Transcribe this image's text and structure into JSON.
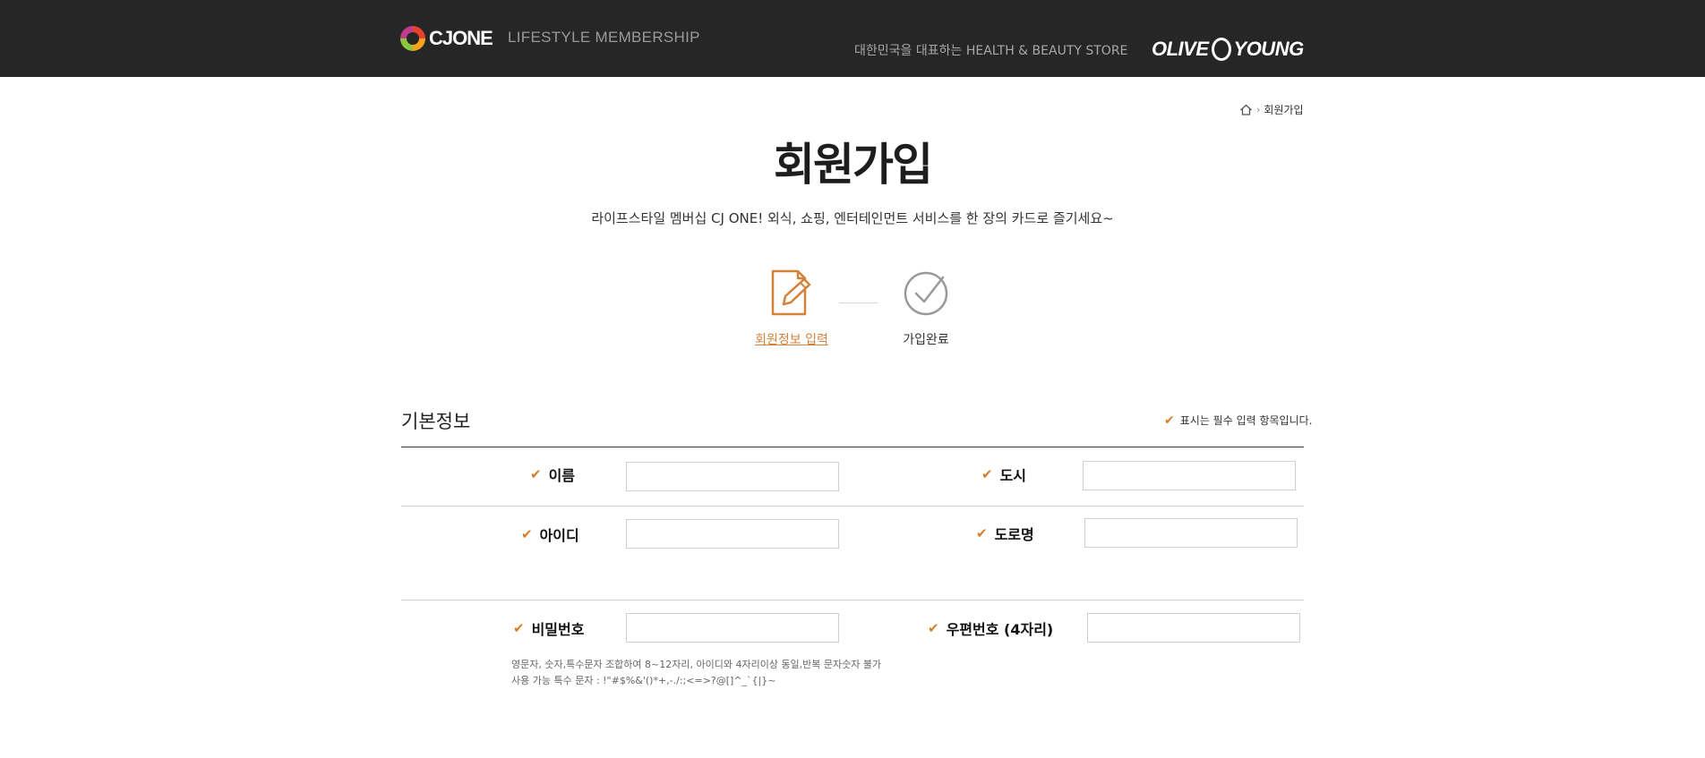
{
  "header": {
    "logo_text": "CJONE",
    "tagline": "LIFESTYLE MEMBERSHIP",
    "store_line": "대한민국을 대표하는 HEALTH & BEAUTY STORE",
    "oy_left": "OLIVE",
    "oy_right": "YOUNG"
  },
  "breadcrumb": {
    "current": "회원가입"
  },
  "page": {
    "title": "회원가입",
    "subtitle": "라이프스타일 멤버십 CJ ONE! 외식, 쇼핑, 엔터테인먼트 서비스를 한 장의 카드로 즐기세요~"
  },
  "steps": [
    {
      "label": "회원정보 입력"
    },
    {
      "label": "가입완료"
    }
  ],
  "section": {
    "title": "기본정보",
    "required_note": "표시는 필수 입력 항목입니다."
  },
  "fields": {
    "name": {
      "label": "이름",
      "value": ""
    },
    "city": {
      "label": "도시",
      "value": ""
    },
    "id": {
      "label": "아이디",
      "value": ""
    },
    "road": {
      "label": "도로명",
      "value": ""
    },
    "password": {
      "label": "비밀번호",
      "value": ""
    },
    "zip": {
      "label": "우편번호 (4자리)",
      "value": ""
    }
  },
  "password_hints": [
    "영문자, 숫자,특수문자 조합하여 8~12자리, 아이디와 4자리이상 동일,반복 문자숫자 불가",
    "사용 가능 특수 문자 : !\"#$%&'()*+,-./:;<=>?@[]^_`{|}~"
  ],
  "colors": {
    "accent": "#d4823a",
    "header_bg": "#262626"
  }
}
